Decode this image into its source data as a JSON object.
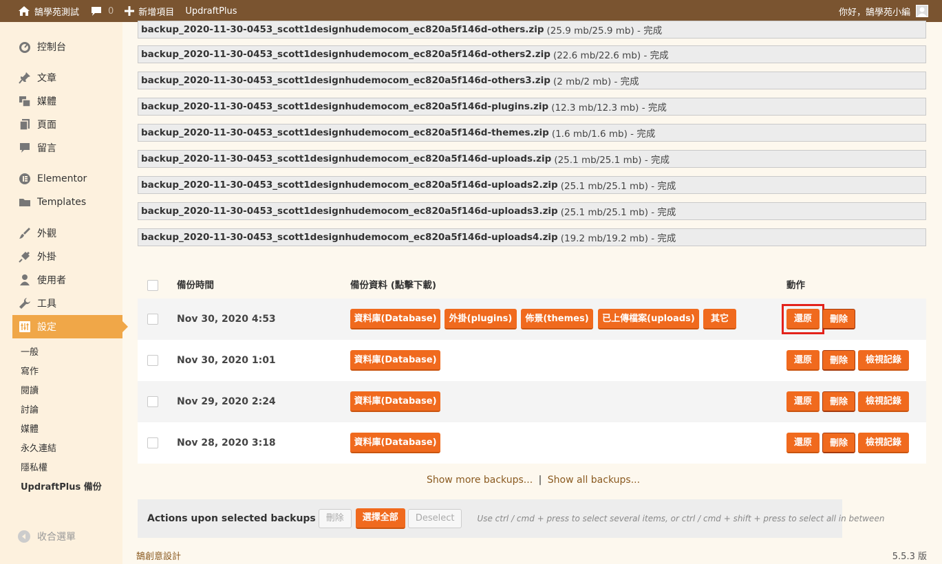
{
  "adminbar": {
    "site_name": "鵠學苑測試",
    "comments_count": "0",
    "new_item": "新增項目",
    "plugin": "UpdraftPlus",
    "greeting": "你好，鵠學苑小編"
  },
  "sidebar": {
    "items": [
      {
        "label": "控制台",
        "icon": "dashboard-icon"
      },
      {
        "label": "文章",
        "icon": "pin-icon"
      },
      {
        "label": "媒體",
        "icon": "media-icon"
      },
      {
        "label": "頁面",
        "icon": "page-icon"
      },
      {
        "label": "留言",
        "icon": "comment-icon"
      },
      {
        "label": "Elementor",
        "icon": "elementor-icon"
      },
      {
        "label": "Templates",
        "icon": "folder-icon"
      },
      {
        "label": "外觀",
        "icon": "brush-icon"
      },
      {
        "label": "外掛",
        "icon": "plugin-icon"
      },
      {
        "label": "使用者",
        "icon": "user-icon"
      },
      {
        "label": "工具",
        "icon": "wrench-icon"
      },
      {
        "label": "設定",
        "icon": "settings-icon"
      }
    ],
    "submenu": [
      "一般",
      "寫作",
      "閱讀",
      "討論",
      "媒體",
      "永久連結",
      "隱私權",
      "UpdraftPlus 備份"
    ],
    "collapse": "收合選單"
  },
  "files": [
    {
      "name": "backup_2020-11-30-0453_scott1designhudemocom_ec820a5f146d-others.zip",
      "meta": "(25.9 mb/25.9 mb) - 完成"
    },
    {
      "name": "backup_2020-11-30-0453_scott1designhudemocom_ec820a5f146d-others2.zip",
      "meta": "(22.6 mb/22.6 mb) - 完成"
    },
    {
      "name": "backup_2020-11-30-0453_scott1designhudemocom_ec820a5f146d-others3.zip",
      "meta": "(2 mb/2 mb) - 完成"
    },
    {
      "name": "backup_2020-11-30-0453_scott1designhudemocom_ec820a5f146d-plugins.zip",
      "meta": "(12.3 mb/12.3 mb) - 完成"
    },
    {
      "name": "backup_2020-11-30-0453_scott1designhudemocom_ec820a5f146d-themes.zip",
      "meta": "(1.6 mb/1.6 mb) - 完成"
    },
    {
      "name": "backup_2020-11-30-0453_scott1designhudemocom_ec820a5f146d-uploads.zip",
      "meta": "(25.1 mb/25.1 mb) - 完成"
    },
    {
      "name": "backup_2020-11-30-0453_scott1designhudemocom_ec820a5f146d-uploads2.zip",
      "meta": "(25.1 mb/25.1 mb) - 完成"
    },
    {
      "name": "backup_2020-11-30-0453_scott1designhudemocom_ec820a5f146d-uploads3.zip",
      "meta": "(25.1 mb/25.1 mb) - 完成"
    },
    {
      "name": "backup_2020-11-30-0453_scott1designhudemocom_ec820a5f146d-uploads4.zip",
      "meta": "(19.2 mb/19.2 mb) - 完成"
    }
  ],
  "table": {
    "headers": {
      "time": "備份時間",
      "data": "備份資料 (點擊下載)",
      "actions": "動作"
    },
    "rows": [
      {
        "date": "Nov 30, 2020 4:53",
        "components": [
          "資料庫(Database)",
          "外掛(plugins)",
          "佈景(themes)",
          "已上傳檔案(uploads)",
          "其它"
        ],
        "actions": [
          "還原",
          "刪除"
        ]
      },
      {
        "date": "Nov 30, 2020 1:01",
        "components": [
          "資料庫(Database)"
        ],
        "actions": [
          "還原",
          "刪除",
          "檢視記錄"
        ]
      },
      {
        "date": "Nov 29, 2020 2:24",
        "components": [
          "資料庫(Database)"
        ],
        "actions": [
          "還原",
          "刪除",
          "檢視記錄"
        ]
      },
      {
        "date": "Nov 28, 2020 3:18",
        "components": [
          "資料庫(Database)"
        ],
        "actions": [
          "還原",
          "刪除",
          "檢視記錄"
        ]
      }
    ]
  },
  "more": {
    "show_more": "Show more backups...",
    "separator": "|",
    "show_all": "Show all backups..."
  },
  "actionsbar": {
    "label": "Actions upon selected backups",
    "delete": "刪除",
    "select_all": "選擇全部",
    "deselect": "Deselect",
    "hint": "Use ctrl / cmd + press to select several items, or ctrl / cmd + shift + press to select all in between"
  },
  "footer": {
    "left": "鵠創意設計",
    "version": "5.5.3 版"
  },
  "colors": {
    "adminbar": "#7a5430",
    "sidebar": "#fdf1de",
    "active": "#f0a748",
    "button": "#f06a1e",
    "highlight": "#e3221b"
  }
}
